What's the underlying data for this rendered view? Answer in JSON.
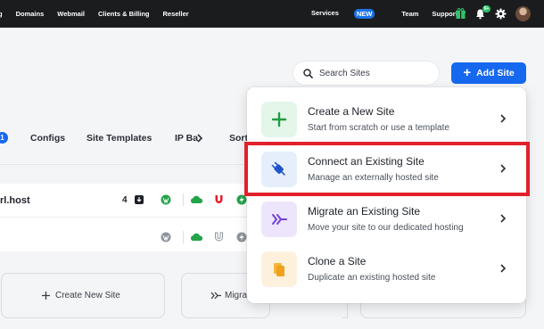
{
  "topnav": {
    "left_items": [
      "g",
      "Domains",
      "Webmail",
      "Clients & Billing",
      "Reseller"
    ],
    "right_items": [
      "Services",
      "Team",
      "Support"
    ],
    "services_badge": "NEW",
    "bell_count": "9+",
    "icons": [
      "gift-icon",
      "bell-icon",
      "gear-icon",
      "user-avatar"
    ]
  },
  "search": {
    "label": "Search Sites"
  },
  "add_site": {
    "label": "Add Site"
  },
  "tabs": {
    "count_badge": "1",
    "items": [
      "Configs",
      "Site Templates",
      "IP Ba",
      "Sort"
    ]
  },
  "site_row": {
    "domain": "rl.host",
    "count": "4"
  },
  "bottom_cards": [
    "Create New Site",
    "Migra"
  ],
  "dropdown": {
    "items": [
      {
        "title": "Create a New Site",
        "desc": "Start from scratch or use a template",
        "icon": "plus-icon",
        "bg": "#e3f6e9",
        "fg": "#1f9e45"
      },
      {
        "title": "Connect an Existing Site",
        "desc": "Manage an externally hosted site",
        "icon": "plug-icon",
        "bg": "#e6eefc",
        "fg": "#1f55c9"
      },
      {
        "title": "Migrate an Existing Site",
        "desc": "Move your site to our dedicated hosting",
        "icon": "migrate-icon",
        "bg": "#ede5fb",
        "fg": "#7040d8"
      },
      {
        "title": "Clone a Site",
        "desc": "Duplicate an existing hosted site",
        "icon": "clone-icon",
        "bg": "#fdf1de",
        "fg": "#f0a11a"
      }
    ]
  },
  "colors": {
    "accent": "#1668ef",
    "highlight": "#e2202a",
    "topbar": "#1b1c1e"
  }
}
